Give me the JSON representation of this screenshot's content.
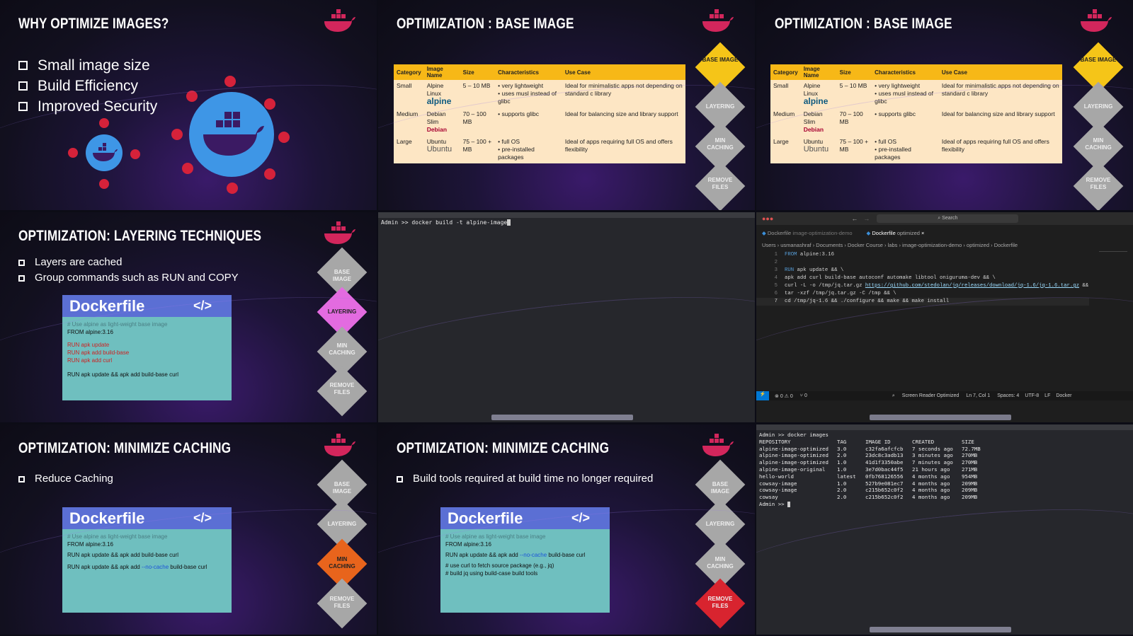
{
  "colors": {
    "accent_red": "#d3265c",
    "yellow": "#f5c518",
    "pink": "#e36be0",
    "orange": "#e8641c",
    "red": "#d8242f",
    "gray": "#a7a7a7"
  },
  "nav": {
    "base": "BASE IMAGE",
    "layering": "LAYERING",
    "caching": "MIN CACHING",
    "remove": "REMOVE FILES"
  },
  "s1": {
    "title": "WHY OPTIMIZE IMAGES?",
    "bullets": [
      "Small image size",
      "Build Efficiency",
      "Improved Security"
    ]
  },
  "table": {
    "headers": [
      "Category",
      "Image Name",
      "Size",
      "Characteristics",
      "Use Case"
    ],
    "rows": [
      {
        "cat": "Small",
        "name": "Alpine Linux",
        "logo": "alpine",
        "size": "5 – 10 MB",
        "chars": [
          "very lightweight",
          "uses musl instead of glibc"
        ],
        "use": "Ideal for minimalistic apps not depending on standard c library"
      },
      {
        "cat": "Medium",
        "name": "Debian Slim",
        "logo": "Debian",
        "size": "70 – 100 MB",
        "chars": [
          "supports glibc"
        ],
        "use": "Ideal for balancing size and library support"
      },
      {
        "cat": "Large",
        "name": "Ubuntu",
        "logo": "Ubuntu",
        "size": "75 – 100 + MB",
        "chars": [
          "full OS",
          "pre-installed packages"
        ],
        "use": "Ideal of apps requiring full OS and offers flexibility"
      }
    ]
  },
  "s2": {
    "title": "OPTIMIZATION : BASE IMAGE"
  },
  "s4": {
    "title": "OPTIMIZATION: LAYERING TECHNIQUES",
    "bullets": [
      "Layers are cached",
      "Group commands such as RUN and COPY"
    ]
  },
  "dockerfile": {
    "heading": "Dockerfile",
    "tag": "</>",
    "comment": "# Use alpine as light-weight base image",
    "from": "FROM alpine:3.16"
  },
  "s4df": {
    "run1": "RUN apk update",
    "run2": "RUN apk add build-base",
    "run3": "RUN apk add curl",
    "combined": "RUN apk update && apk add build-base curl"
  },
  "terminal1": {
    "command": "Admin >> docker build -t alpine-image"
  },
  "vscode": {
    "search": "Search",
    "tab1": "Dockerfile",
    "tab1_sub": "image-optimization-demo",
    "tab2": "Dockerfile",
    "tab2_sub": "optimized",
    "breadcrumb": [
      "Users",
      "usmanashraf",
      "Documents",
      "Docker Course",
      "labs",
      "image-optimization-demo",
      "optimized",
      "Dockerfile"
    ],
    "lines": [
      {
        "n": "1",
        "kw": "FROM",
        "rest": " alpine:3.16"
      },
      {
        "n": "2",
        "kw": "",
        "rest": ""
      },
      {
        "n": "3",
        "kw": "RUN",
        "rest": " apk update && \\"
      },
      {
        "n": "4",
        "kw": "",
        "rest": "apk add curl build-base autoconf automake libtool oniguruma-dev && \\"
      },
      {
        "n": "5",
        "kw": "",
        "rest": "curl -L -o /tmp/jq.tar.gz ",
        "url": "https://github.com/stedolan/jq/releases/download/jq-1.6/jq-1.6.tar.gz",
        "tail": " &&"
      },
      {
        "n": "6",
        "kw": "",
        "rest": "tar -xzf /tmp/jq.tar.gz -C /tmp && \\"
      },
      {
        "n": "7",
        "kw": "",
        "rest": "cd /tmp/jq-1.6 && ./configure && make && make install"
      }
    ],
    "status": {
      "errors": "0",
      "warnings": "0",
      "ports": "0",
      "reader": "Screen Reader Optimized",
      "pos": "Ln 7, Col 1",
      "spaces": "Spaces: 4",
      "enc": "UTF-8",
      "eol": "LF",
      "lang": "Docker"
    }
  },
  "s7": {
    "title": "OPTIMIZATION: MINIMIZE CACHING",
    "bullets": [
      "Reduce Caching"
    ],
    "line1": "RUN apk update && apk add build-base curl",
    "line2_a": "RUN apk update && apk add ",
    "line2_b": "--no-cache",
    "line2_c": " build-base curl"
  },
  "s8": {
    "title": "OPTIMIZATION: MINIMIZE CACHING",
    "bullets": [
      "Build tools required at build time no longer required"
    ],
    "line1_a": "RUN apk update && apk add ",
    "line1_b": "--no-cache",
    "line1_c": " build-base curl",
    "c1": "# use curl to fetch source package (e.g., jq)",
    "c2": "# build jq using build-case build tools"
  },
  "terminal2": {
    "command": "Admin >> docker images",
    "headers": [
      "REPOSITORY",
      "TAG",
      "IMAGE ID",
      "CREATED",
      "SIZE"
    ],
    "rows": [
      [
        "alpine-image-optimized",
        "3.0",
        "c32fa6afcfcb",
        "7 seconds ago",
        "72.7MB"
      ],
      [
        "alpine-image-optimized",
        "2.0",
        "23dc8c3adb13",
        "3 minutes ago",
        "270MB"
      ],
      [
        "alpine-image-optimized",
        "1.0",
        "41d1f3350abe",
        "7 minutes ago",
        "270MB"
      ],
      [
        "alpine-image-original",
        "1.0",
        "3e7d0bac44f5",
        "21 hours ago",
        "271MB"
      ],
      [
        "hello-world",
        "latest",
        "0fb768126556",
        "4 months ago",
        "954MB"
      ],
      [
        "cowsay-image",
        "1.0",
        "527b9e081ec7",
        "4 months ago",
        "209MB"
      ],
      [
        "cowsay-image",
        "2.0",
        "c215b652c0f2",
        "4 months ago",
        "209MB"
      ],
      [
        "cowsay",
        "2.0",
        "c215b652c0f2",
        "4 months ago",
        "209MB"
      ]
    ],
    "prompt": "Admin >>"
  }
}
